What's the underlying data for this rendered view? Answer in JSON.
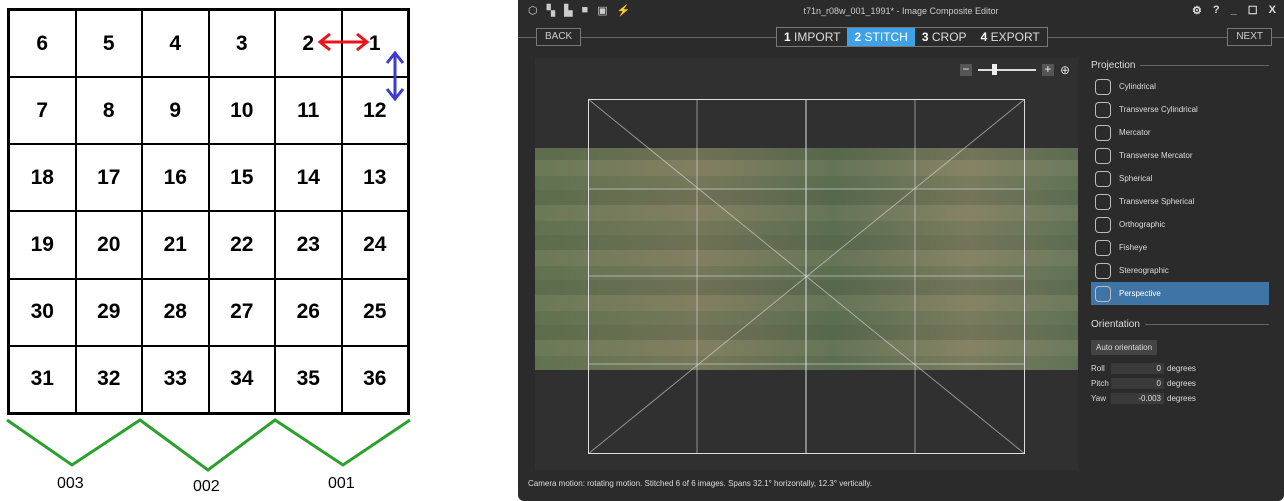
{
  "diagram": {
    "cells": [
      "6",
      "5",
      "4",
      "3",
      "2",
      "1",
      "7",
      "8",
      "9",
      "10",
      "11",
      "12",
      "18",
      "17",
      "16",
      "15",
      "14",
      "13",
      "19",
      "20",
      "21",
      "22",
      "23",
      "24",
      "30",
      "29",
      "28",
      "27",
      "26",
      "25",
      "31",
      "32",
      "33",
      "34",
      "35",
      "36"
    ],
    "swaths": [
      "003",
      "002",
      "001"
    ],
    "colors": {
      "horizontal_arrow": "#e8141c",
      "vertical_arrow": "#3b3bd0",
      "swath_lines": "#2ca02c"
    }
  },
  "app": {
    "title": "t71n_r08w_001_1991* - Image Composite Editor",
    "toolbar_icons": [
      "new-panorama-icon",
      "new-from-video-icon",
      "new-from-images-icon",
      "open-icon",
      "save-icon",
      "publish-icon"
    ],
    "window_controls": [
      "⚙",
      "?",
      "_",
      "☐",
      "X"
    ],
    "back_label": "BACK",
    "next_label": "NEXT",
    "steps": [
      {
        "num": "1",
        "label": "IMPORT"
      },
      {
        "num": "2",
        "label": "STITCH",
        "active": true
      },
      {
        "num": "3",
        "label": "CROP"
      },
      {
        "num": "4",
        "label": "EXPORT"
      }
    ],
    "zoom": {
      "minus": "−",
      "plus": "+",
      "level": 0.25
    },
    "status": "Camera motion: rotating motion. Stitched 6 of 6 images. Spans 32.1° horizontally, 12.3° vertically.",
    "projection": {
      "heading": "Projection",
      "items": [
        "Cylindrical",
        "Transverse Cylindrical",
        "Mercator",
        "Transverse Mercator",
        "Spherical",
        "Transverse Spherical",
        "Orthographic",
        "Fisheye",
        "Stereographic",
        "Perspective"
      ],
      "selected": "Perspective"
    },
    "orientation": {
      "heading": "Orientation",
      "auto_label": "Auto orientation",
      "unit": "degrees",
      "roll_label": "Roll",
      "roll": "0",
      "pitch_label": "Pitch",
      "pitch": "0",
      "yaw_label": "Yaw",
      "yaw": "-0.003"
    },
    "accent": "#3ea2e8",
    "selected_bg": "#3e75a6"
  }
}
